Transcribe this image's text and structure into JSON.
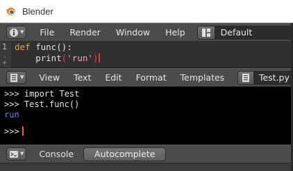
{
  "window": {
    "title": "Blender"
  },
  "info_header": {
    "icon": "info-icon",
    "menus": [
      "File",
      "Render",
      "Window",
      "Help"
    ],
    "layout_icon": "screen-layout-icon",
    "layout_value": "Default"
  },
  "text_editor": {
    "line_number": "1",
    "code_lines": [
      {
        "keyword": "def",
        "rest": " func():"
      },
      {
        "indent": "    ",
        "fn": "print",
        "open": "(",
        "string": "'run'",
        "close": ")"
      }
    ]
  },
  "text_header": {
    "icon": "text-editor-icon",
    "menus": [
      "View",
      "Text",
      "Edit",
      "Format",
      "Templates"
    ],
    "datablock_icon": "text-datablock-icon",
    "datablock_value": "Test.py"
  },
  "console": {
    "lines": [
      {
        "text": ">>> import Test",
        "kind": "input"
      },
      {
        "text": ">>> Test.func()",
        "kind": "input"
      },
      {
        "text": "run",
        "kind": "output"
      }
    ],
    "prompt": ">>>"
  },
  "console_header": {
    "icon": "console-icon",
    "menus": [
      "Console"
    ],
    "autocomplete_label": "Autocomplete"
  },
  "colors": {
    "keyword": "#e8a34d",
    "string": "#f0a0c0",
    "output": "#6b7cff",
    "cursor": "#ff2a2a",
    "blender_orange": "#f08c1a",
    "blender_blue": "#2f66a9"
  }
}
